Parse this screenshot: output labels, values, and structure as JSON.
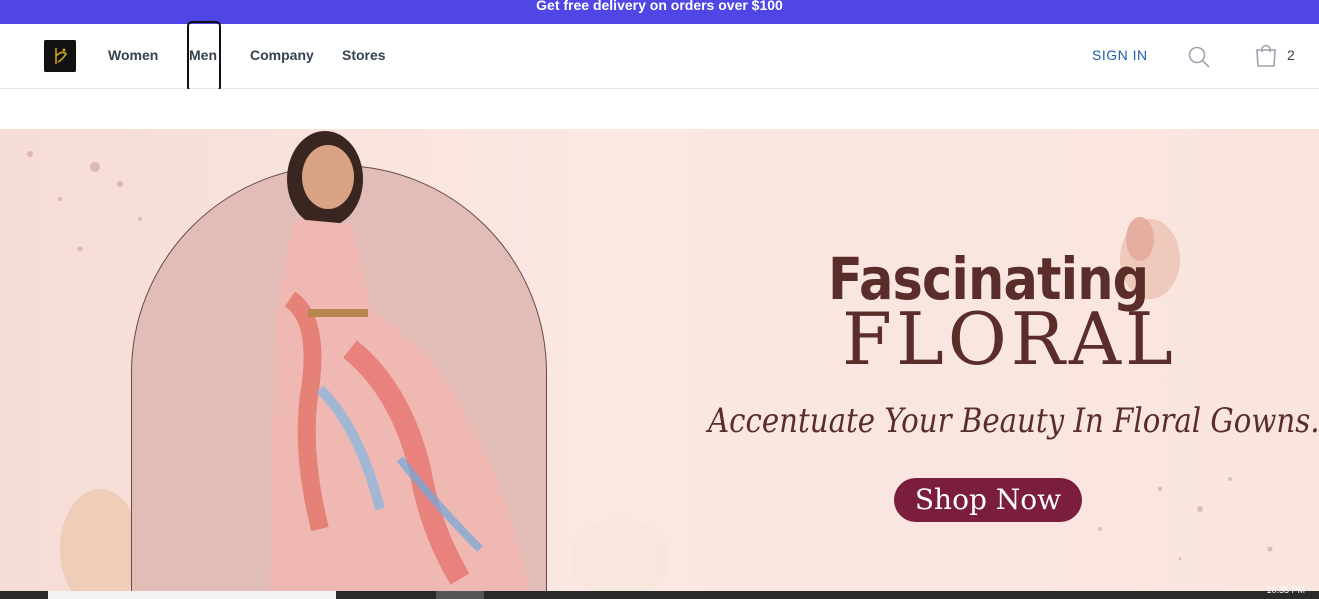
{
  "promo": {
    "text": "Get free delivery on orders over $100"
  },
  "nav": {
    "links": [
      {
        "label": "Women"
      },
      {
        "label": "Men"
      },
      {
        "label": "Company"
      },
      {
        "label": "Stores"
      }
    ],
    "sign_in": "SIGN IN",
    "cart_count": "2"
  },
  "hero": {
    "headline_top": "Fascinating",
    "headline_bottom": "FLORAL",
    "tagline": "Accentuate Your Beauty In Floral Gowns.",
    "cta": "Shop Now"
  },
  "taskbar": {
    "clock": "10:35 PM"
  },
  "colors": {
    "promo_bg": "#4f46e5",
    "sign_in": "#1f5fa8",
    "headline": "#5a2d2a",
    "cta_bg": "#7b1d3c"
  }
}
